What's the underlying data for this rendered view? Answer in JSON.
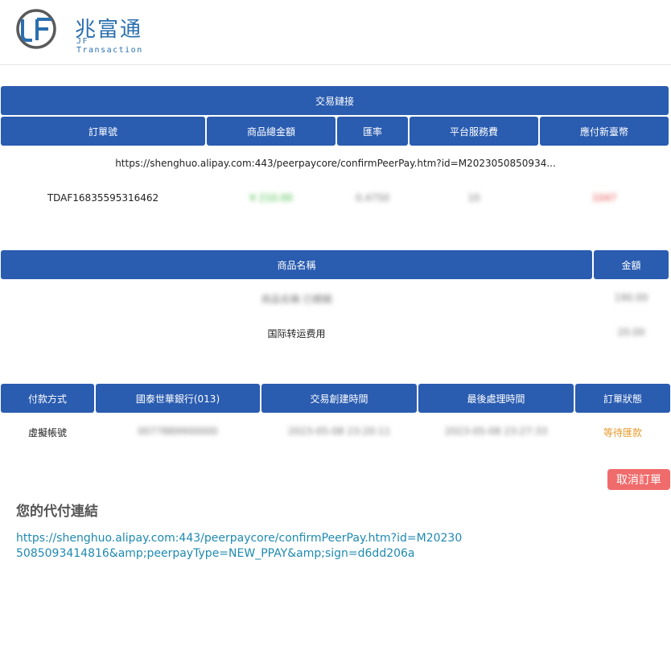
{
  "brand": {
    "name_cn": "兆富通",
    "name_en": "JF Transaction"
  },
  "colors": {
    "header_bar": "#2a5cb0",
    "link": "#1f8ab0",
    "cancel": "#f06b6b",
    "status_waiting": "#e49a2b"
  },
  "transaction": {
    "link_header": "交易鏈接",
    "columns": [
      "訂單號",
      "商品總金額",
      "匯率",
      "平台服務費",
      "應付新臺幣"
    ],
    "link": "https://shenghuo.alipay.com:443/peerpaycore/confirmPeerPay.htm?id=M2023050850934...",
    "order_no": "TDAF16835595316462",
    "total_amount": "¥ 210.00",
    "rate": "0.4750",
    "fee": "10",
    "payable": "1047"
  },
  "items": {
    "columns": [
      "商品名稱",
      "金額"
    ],
    "rows": [
      {
        "name": "商品名稱 已模糊",
        "amount": "190.00"
      },
      {
        "name": "国际转运费用",
        "amount": "20.00"
      }
    ]
  },
  "payment": {
    "columns": [
      "付款方式",
      "國泰世華銀行(013)",
      "交易創建時間",
      "最後處理時間",
      "訂單狀態"
    ],
    "method": "虛擬帳號",
    "account": "0077889900000",
    "created": "2023-05-08 23:20:11",
    "updated": "2023-05-08 23:27:33",
    "status": "等待匯款"
  },
  "actions": {
    "cancel_label": "取消訂單"
  },
  "share": {
    "title": "您的代付連結",
    "link": "https://shenghuo.alipay.com:443/peerpaycore/confirmPeerPay.htm?id=M202305085093414816&amp;peerpayType=NEW_PPAY&amp;sign=d6dd206a"
  }
}
